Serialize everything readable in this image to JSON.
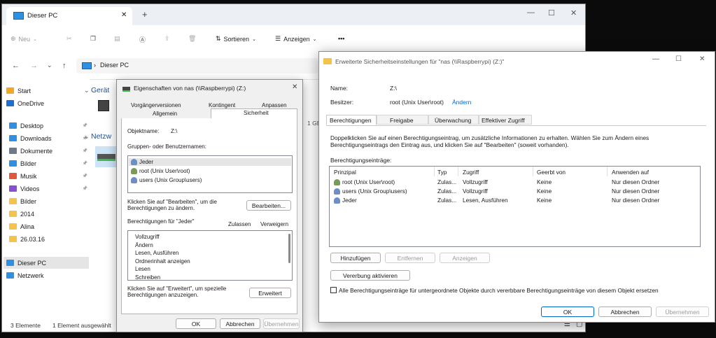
{
  "explorer": {
    "tab_title": "Dieser PC",
    "tab_close": "✕",
    "tab_add": "+",
    "toolbar": {
      "new_label": "Neu",
      "sort_label": "Sortieren",
      "view_label": "Anzeigen",
      "more_label": "•••"
    },
    "address": {
      "path": "Dieser PC"
    },
    "sidebar": {
      "items": [
        {
          "label": "Start",
          "color": "#f5a623"
        },
        {
          "label": "OneDrive",
          "color": "#1f6fd1"
        },
        {
          "label": "Desktop",
          "color": "#2f8fe0"
        },
        {
          "label": "Downloads",
          "color": "#2f8fe0"
        },
        {
          "label": "Dokumente",
          "color": "#6c7a89"
        },
        {
          "label": "Bilder",
          "color": "#2f8fe0"
        },
        {
          "label": "Musik",
          "color": "#e0573b"
        },
        {
          "label": "Videos",
          "color": "#8a4fd1"
        },
        {
          "label": "Bilder",
          "color": "#f3c34a"
        },
        {
          "label": "2014",
          "color": "#f3c34a"
        },
        {
          "label": "Alina",
          "color": "#f3c34a"
        },
        {
          "label": "26.03.16",
          "color": "#f3c34a"
        },
        {
          "label": "Dieser PC",
          "color": "#2f8fe0"
        },
        {
          "label": "Netzwerk",
          "color": "#2f8fe0"
        }
      ]
    },
    "content": {
      "group1": "Gerät",
      "group2": "Netzw",
      "size_partial": "1 GB"
    },
    "status": {
      "count": "3 Elemente",
      "selected": "1 Element ausgewählt"
    }
  },
  "properties_dialog": {
    "title": "Eigenschaften von nas (\\\\Raspberrypi) (Z:)",
    "tabs_row1": [
      "Vorgängerversionen",
      "Kontingent",
      "Anpassen"
    ],
    "tabs_row2": [
      "Allgemein",
      "Sicherheit"
    ],
    "object_label": "Objektname:",
    "object_value": "Z:\\",
    "groups_label": "Gruppen- oder Benutzernamen:",
    "groups": [
      "Jeder",
      "root (Unix User\\root)",
      "users (Unix Group\\users)"
    ],
    "edit_hint": "Klicken Sie auf \"Bearbeiten\", um die Berechtigungen zu ändern.",
    "edit_button": "Bearbeiten...",
    "perm_header": "Berechtigungen für \"Jeder\"",
    "allow_header": "Zulassen",
    "deny_header": "Verweigern",
    "permissions": [
      "Vollzugriff",
      "Ändern",
      "Lesen, Ausführen",
      "Ordnerinhalt anzeigen",
      "Lesen",
      "Schreiben"
    ],
    "advanced_hint": "Klicken Sie auf \"Erweitert\", um spezielle Berechtigungen anzuzeigen.",
    "advanced_button": "Erweitert",
    "ok": "OK",
    "cancel": "Abbrechen",
    "apply": "Übernehmen"
  },
  "advanced_dialog": {
    "title": "Erweiterte Sicherheitseinstellungen für \"nas (\\\\Raspberrypi) (Z:)\"",
    "name_label": "Name:",
    "name_value": "Z:\\",
    "owner_label": "Besitzer:",
    "owner_value": "root (Unix User\\root)",
    "owner_change": "Ändern",
    "tabs": [
      "Berechtigungen",
      "Freigabe",
      "Überwachung",
      "Effektiver Zugriff"
    ],
    "info_text": "Doppelklicken Sie auf einen Berechtigungseintrag, um zusätzliche Informationen zu erhalten. Wählen Sie zum Ändern eines Berechtigungseintrags den Eintrag aus, und klicken Sie auf \"Bearbeiten\" (soweit vorhanden).",
    "entries_label": "Berechtigungseinträge:",
    "columns": [
      "Prinzipal",
      "Typ",
      "Zugriff",
      "Geerbt von",
      "Anwenden auf"
    ],
    "rows": [
      {
        "principal": "root (Unix User\\root)",
        "type": "Zulas...",
        "access": "Vollzugriff",
        "inherited": "Keine",
        "applies": "Nur diesen Ordner"
      },
      {
        "principal": "users (Unix Group\\users)",
        "type": "Zulas...",
        "access": "Vollzugriff",
        "inherited": "Keine",
        "applies": "Nur diesen Ordner"
      },
      {
        "principal": "Jeder",
        "type": "Zulas...",
        "access": "Lesen, Ausführen",
        "inherited": "Keine",
        "applies": "Nur diesen Ordner"
      }
    ],
    "add_button": "Hinzufügen",
    "remove_button": "Entfernen",
    "view_button": "Anzeigen",
    "inherit_button": "Vererbung aktivieren",
    "replace_checkbox": "Alle Berechtigungseinträge für untergeordnete Objekte durch vererbbare Berechtigungseinträge von diesem Objekt ersetzen",
    "ok": "OK",
    "cancel": "Abbrechen",
    "apply": "Übernehmen"
  }
}
